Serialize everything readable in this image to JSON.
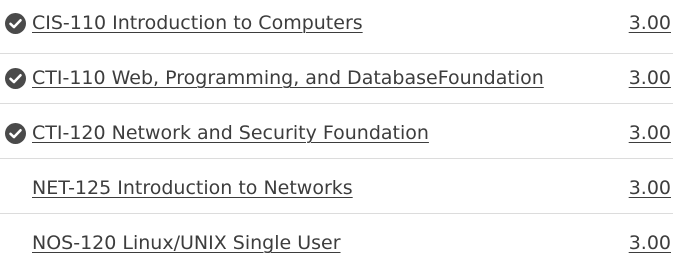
{
  "courses": [
    {
      "name": "CIS-110 Introduction to Computers",
      "credits": "3.00",
      "completed": true
    },
    {
      "name": "CTI-110 Web, Programming, and DatabaseFoundation",
      "credits": "3.00",
      "completed": true
    },
    {
      "name": "CTI-120 Network and Security Foundation",
      "credits": "3.00",
      "completed": true
    },
    {
      "name": "NET-125 Introduction to Networks",
      "credits": "3.00",
      "completed": false
    },
    {
      "name": "NOS-120 Linux/UNIX Single User",
      "credits": "3.00",
      "completed": false
    }
  ],
  "icons": {
    "completed": "check-circle-icon"
  },
  "colors": {
    "icon": "#4a4a4a",
    "text": "#3d3d3d",
    "divider": "#dcdcdc"
  }
}
